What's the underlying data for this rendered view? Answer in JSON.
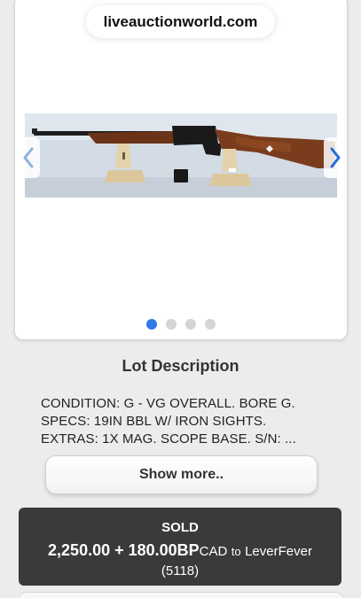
{
  "browser": {
    "url": "liveauctionworld.com"
  },
  "gallery": {
    "image_description_icon": "rifle-photo",
    "dot_count": 4,
    "active_index": 0,
    "prev_icon": "chevron-left-icon",
    "next_icon": "chevron-right-icon",
    "accent_color": "#2d7be5"
  },
  "lot": {
    "section_title": "Lot Description",
    "description_lines": [
      "CONDITION: G - VG OVERALL. BORE G.",
      "SPECS: 19IN BBL W/ IRON SIGHTS.",
      "EXTRAS: 1X MAG. SCOPE BASE. S/N: ..."
    ],
    "show_more_label": "Show more.."
  },
  "result": {
    "status": "SOLD",
    "amount": "2,250.00 + 180.00BP",
    "currency": "CAD",
    "to_word": "to",
    "buyer": "LeverFever",
    "paddle": "(5118)"
  }
}
